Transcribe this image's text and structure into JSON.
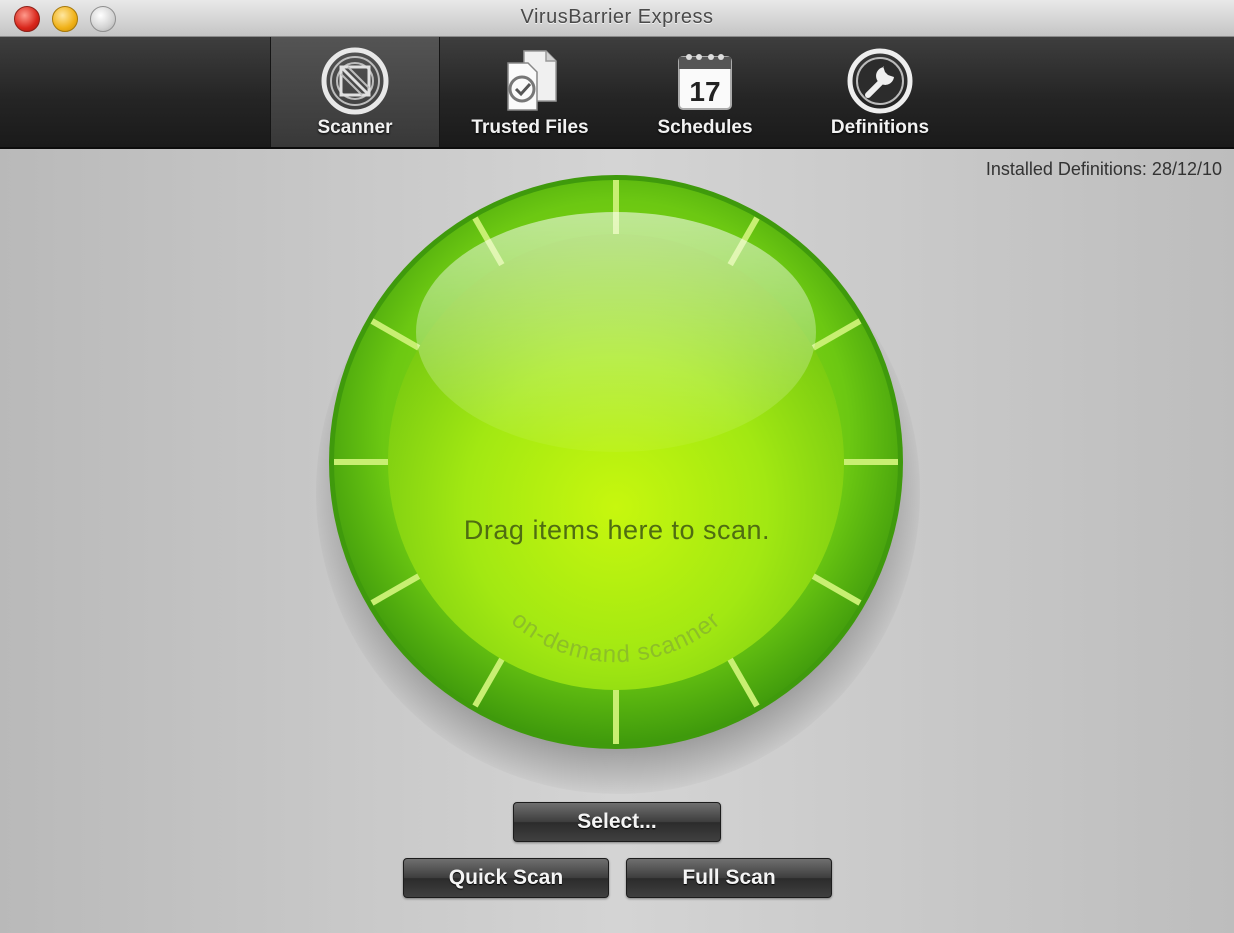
{
  "window": {
    "title": "VirusBarrier Express"
  },
  "toolbar": {
    "items": [
      {
        "label": "Scanner",
        "icon": "scanner-icon",
        "selected": true
      },
      {
        "label": "Trusted Files",
        "icon": "trusted-files-icon",
        "selected": false
      },
      {
        "label": "Schedules",
        "icon": "calendar-icon",
        "selected": false,
        "calendar_day": "17"
      },
      {
        "label": "Definitions",
        "icon": "definitions-icon",
        "selected": false
      }
    ]
  },
  "main": {
    "definitions_status": "Installed Definitions: 28/12/10",
    "drop_text": "Drag items here to scan.",
    "scanner_caption": "on-demand scanner"
  },
  "buttons": {
    "select": "Select...",
    "quick_scan": "Quick Scan",
    "full_scan": "Full Scan"
  },
  "colors": {
    "accent_green": "#9ee80f",
    "ring_green": "#52b012"
  }
}
